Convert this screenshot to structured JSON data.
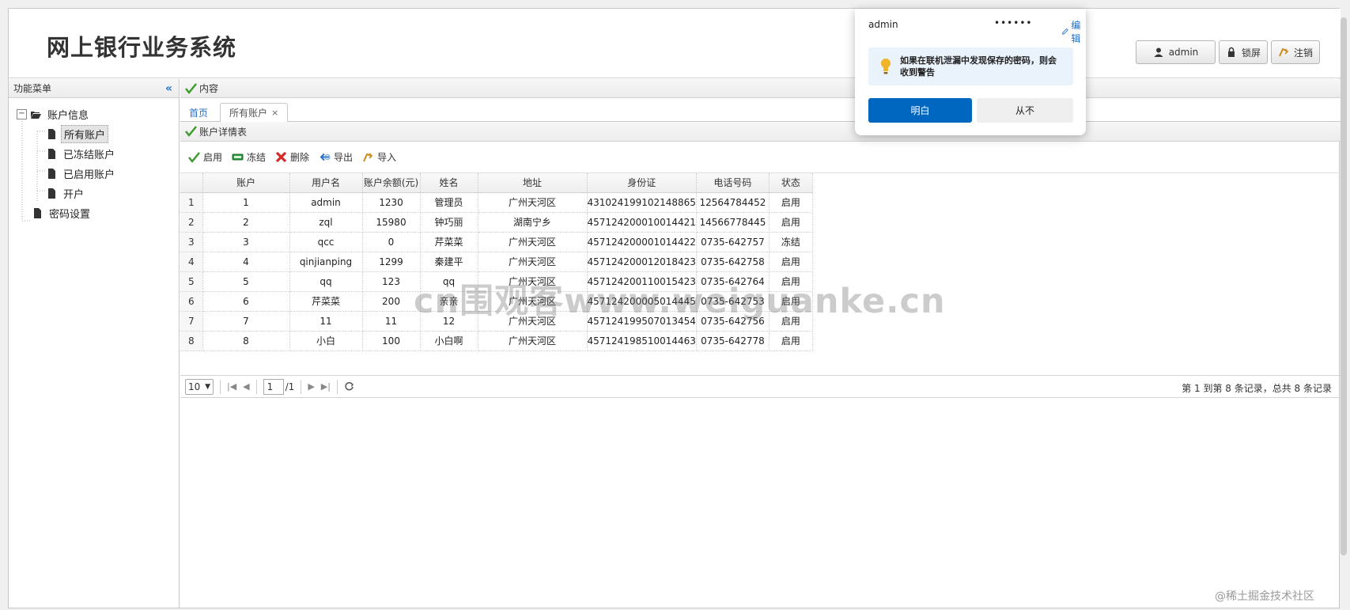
{
  "header": {
    "title": "网上银行业务系统",
    "user_btn": "admin",
    "lock_btn": "锁屏",
    "logout_btn": "注销"
  },
  "sidebar": {
    "title": "功能菜单",
    "collapse_glyph": "«",
    "tree": [
      {
        "label": "账户信息",
        "expanded": true
      },
      {
        "label": "所有账户",
        "selected": true
      },
      {
        "label": "已冻结账户"
      },
      {
        "label": "已启用账户"
      },
      {
        "label": "开户"
      },
      {
        "label": "密码设置"
      }
    ]
  },
  "content": {
    "title": "内容",
    "tabs": [
      {
        "label": "首页"
      },
      {
        "label": "所有账户",
        "close": "×"
      }
    ],
    "panel_title": "账户详情表"
  },
  "toolbar": {
    "enable": "启用",
    "freeze": "冻结",
    "delete": "删除",
    "export": "导出",
    "import": "导入"
  },
  "table": {
    "columns": [
      "账户",
      "用户名",
      "账户余额(元)",
      "姓名",
      "地址",
      "身份证",
      "电话号码",
      "状态"
    ],
    "rows": [
      {
        "n": "1",
        "cells": [
          "1",
          "admin",
          "1230",
          "管理员",
          "广州天河区",
          "431024199102148865",
          "12564784452",
          "启用"
        ]
      },
      {
        "n": "2",
        "cells": [
          "2",
          "zql",
          "15980",
          "钟巧丽",
          "湖南宁乡",
          "457124200010014421",
          "14566778445",
          "启用"
        ]
      },
      {
        "n": "3",
        "cells": [
          "3",
          "qcc",
          "0",
          "芹菜菜",
          "广州天河区",
          "457124200001014422",
          "0735-642757",
          "冻结"
        ]
      },
      {
        "n": "4",
        "cells": [
          "4",
          "qinjianping",
          "1299",
          "秦建平",
          "广州天河区",
          "457124200012018423",
          "0735-642758",
          "启用"
        ]
      },
      {
        "n": "5",
        "cells": [
          "5",
          "qq",
          "123",
          "qq",
          "广州天河区",
          "457124200110015423",
          "0735-642764",
          "启用"
        ]
      },
      {
        "n": "6",
        "cells": [
          "6",
          "芹菜菜",
          "200",
          "亲亲",
          "广州天河区",
          "457124200005014445",
          "0735-642753",
          "启用"
        ]
      },
      {
        "n": "7",
        "cells": [
          "7",
          "11",
          "11",
          "12",
          "广州天河区",
          "457124199507013454",
          "0735-642756",
          "启用"
        ]
      },
      {
        "n": "8",
        "cells": [
          "8",
          "小白",
          "100",
          "小白啊",
          "广州天河区",
          "457124198510014463",
          "0735-642778",
          "启用"
        ]
      }
    ]
  },
  "pager": {
    "page_size": "10",
    "page": "1",
    "total_pages": "/1",
    "info": "第 1 到第 8 条记录，总共 8 条记录"
  },
  "password_popup": {
    "username": "admin",
    "password_mask": "••••••",
    "edit_label": "编辑",
    "warning": "如果在联机泄漏中发现保存的密码，则会收到警告",
    "ok_label": "明白",
    "never_label": "从不"
  },
  "overlay": {
    "watermark": "cn围观客www.weiguanke.cn",
    "corner_mark": "@稀土掘金技术社区"
  },
  "colors": {
    "accent": "#0067c0",
    "link": "#2a74c8",
    "check": "#3a9a2a",
    "delete": "#d62b2b"
  }
}
